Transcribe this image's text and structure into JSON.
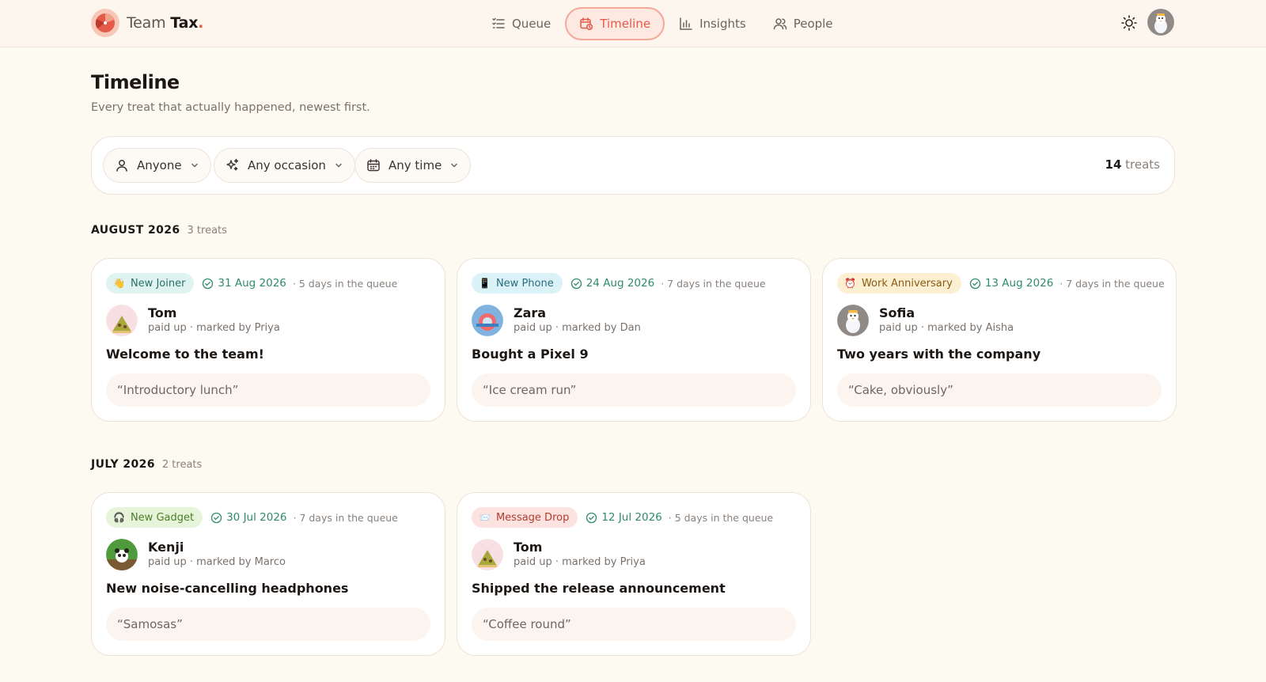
{
  "app": {
    "name_light": "Team",
    "name_bold": "Tax",
    "name_dot": "."
  },
  "nav": {
    "queue": "Queue",
    "timeline": "Timeline",
    "insights": "Insights",
    "people": "People"
  },
  "page": {
    "title": "Timeline",
    "subtitle": "Every treat that actually happened, newest first."
  },
  "filters": {
    "person": "Anyone",
    "occasion": "Any occasion",
    "time": "Any time",
    "count_number": "14",
    "count_label": " treats"
  },
  "sections": [
    {
      "title": "AUGUST 2026",
      "count": "3 treats",
      "cards": [
        {
          "tag": "New Joiner",
          "tag_icon": "waving-hand-icon",
          "tag_color": "#dff4f1",
          "date": "31 Aug 2026",
          "queue": "· 5 days in the queue",
          "name": "Tom",
          "sub": "paid up · marked by Priya",
          "title": "Welcome to the team!",
          "quote": "“Introductory lunch”"
        },
        {
          "tag": "New Phone",
          "tag_icon": "mobile-phone-icon",
          "tag_color": "#dbf2f8",
          "date": "24 Aug 2026",
          "queue": "· 7 days in the queue",
          "name": "Zara",
          "sub": "paid up · marked by Dan",
          "title": "Bought a Pixel 9",
          "quote": "“Ice cream run”"
        },
        {
          "tag": "Work Anniversary",
          "tag_icon": "alarm-clock-icon",
          "tag_color": "#fcefd2",
          "date": "13 Aug 2026",
          "queue": "· 7 days in the queue",
          "name": "Sofia",
          "sub": "paid up · marked by Aisha",
          "title": "Two years with the company",
          "quote": "“Cake, obviously”"
        }
      ]
    },
    {
      "title": "JULY 2026",
      "count": "2 treats",
      "cards": [
        {
          "tag": "New Gadget",
          "tag_icon": "headphones-icon",
          "tag_color": "#e6f5d9",
          "date": "30 Jul 2026",
          "queue": "· 7 days in the queue",
          "name": "Kenji",
          "sub": "paid up · marked by Marco",
          "title": "New noise-cancelling headphones",
          "quote": "“Samosas”"
        },
        {
          "tag": "Message Drop",
          "tag_icon": "envelope-icon",
          "tag_color": "#fde3e0",
          "date": "12 Jul 2026",
          "queue": "· 5 days in the queue",
          "name": "Tom",
          "sub": "paid up · marked by Priya",
          "title": "Shipped the release announcement",
          "quote": "“Coffee round”"
        }
      ]
    }
  ],
  "colors": {
    "accent": "#e25b4b",
    "success": "#2f8a6e",
    "background": "#fdfaf2",
    "card_quote_bg": "#fcf4ee"
  }
}
